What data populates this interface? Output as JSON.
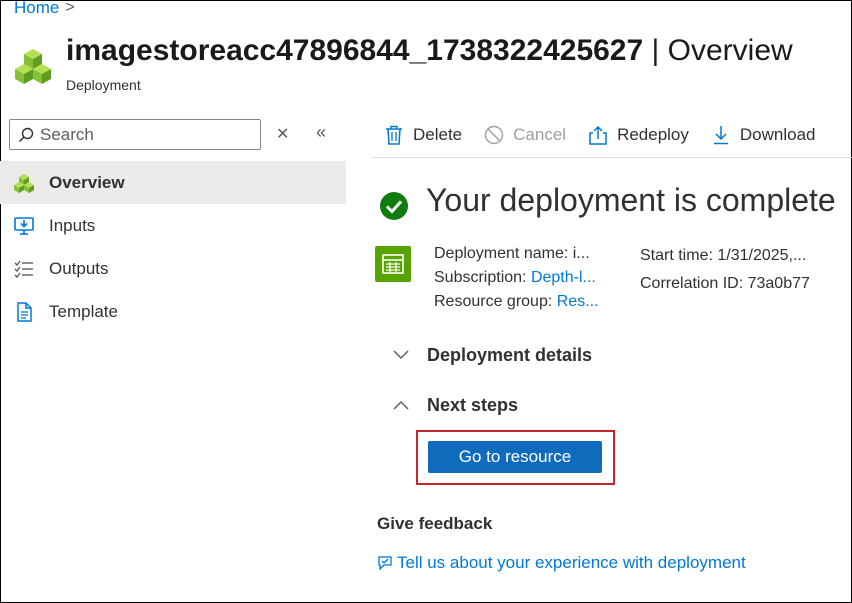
{
  "breadcrumb": {
    "home": "Home",
    "separator": ">"
  },
  "header": {
    "resource_name": "imagestoreacc47896844_1738322425627",
    "section": "| Overview",
    "subtitle": "Deployment",
    "icon": "cubes-icon"
  },
  "sidebar": {
    "search_placeholder": "Search",
    "close_glyph": "✕",
    "collapse_glyph": "«",
    "items": [
      {
        "label": "Overview",
        "icon": "cubes-icon",
        "active": true
      },
      {
        "label": "Inputs",
        "icon": "inputs-icon",
        "active": false
      },
      {
        "label": "Outputs",
        "icon": "outputs-icon",
        "active": false
      },
      {
        "label": "Template",
        "icon": "template-icon",
        "active": false
      }
    ]
  },
  "toolbar": {
    "delete": "Delete",
    "cancel": "Cancel",
    "redeploy": "Redeploy",
    "download": "Download"
  },
  "status": {
    "title": "Your deployment is complete",
    "icon": "check-circle-icon",
    "color": "#107c10"
  },
  "details": {
    "deployment_name_label": "Deployment name:",
    "deployment_name_value": "i...",
    "subscription_label": "Subscription:",
    "subscription_value": "Depth-l...",
    "resource_group_label": "Resource group:",
    "resource_group_value": "Res...",
    "start_time_label": "Start time:",
    "start_time_value": "1/31/2025,...",
    "correlation_label": "Correlation ID:",
    "correlation_value": "73a0b77"
  },
  "sections": {
    "deployment_details": "Deployment details",
    "next_steps": "Next steps"
  },
  "actions": {
    "go_to_resource": "Go to resource"
  },
  "feedback": {
    "heading": "Give feedback",
    "link": "Tell us about your experience with deployment"
  },
  "colors": {
    "accent": "#0078d4",
    "primary_button": "#0f6cbd",
    "success": "#107c10",
    "highlight": "#c4262e",
    "tile": "#57a300"
  }
}
